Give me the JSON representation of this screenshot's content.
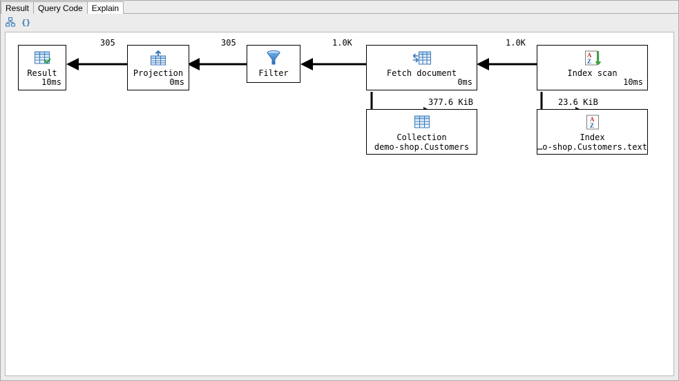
{
  "tabs": [
    {
      "id": "result",
      "label": "Result",
      "active": false
    },
    {
      "id": "querycode",
      "label": "Query Code",
      "active": false
    },
    {
      "id": "explain",
      "label": "Explain",
      "active": true
    }
  ],
  "toolbar": {
    "tree_view": "Tree view",
    "raw_json": "Raw JSON"
  },
  "edges": {
    "result_projection": "305",
    "projection_filter": "305",
    "filter_fetch": "1.0K",
    "fetch_indexscan": "1.0K",
    "fetch_collection": "377.6 KiB",
    "indexscan_index": "23.6 KiB"
  },
  "nodes": {
    "result": {
      "label": "Result",
      "timing": "10ms"
    },
    "projection": {
      "label": "Projection",
      "timing": "0ms"
    },
    "filter": {
      "label": "Filter"
    },
    "fetch": {
      "label": "Fetch document",
      "timing": "0ms"
    },
    "indexscan": {
      "label": "Index scan",
      "timing": "10ms"
    },
    "collection": {
      "label": "Collection",
      "sublabel": "demo-shop.Customers"
    },
    "index": {
      "label": "Index",
      "sublabel": "…o-shop.Customers.text"
    }
  }
}
